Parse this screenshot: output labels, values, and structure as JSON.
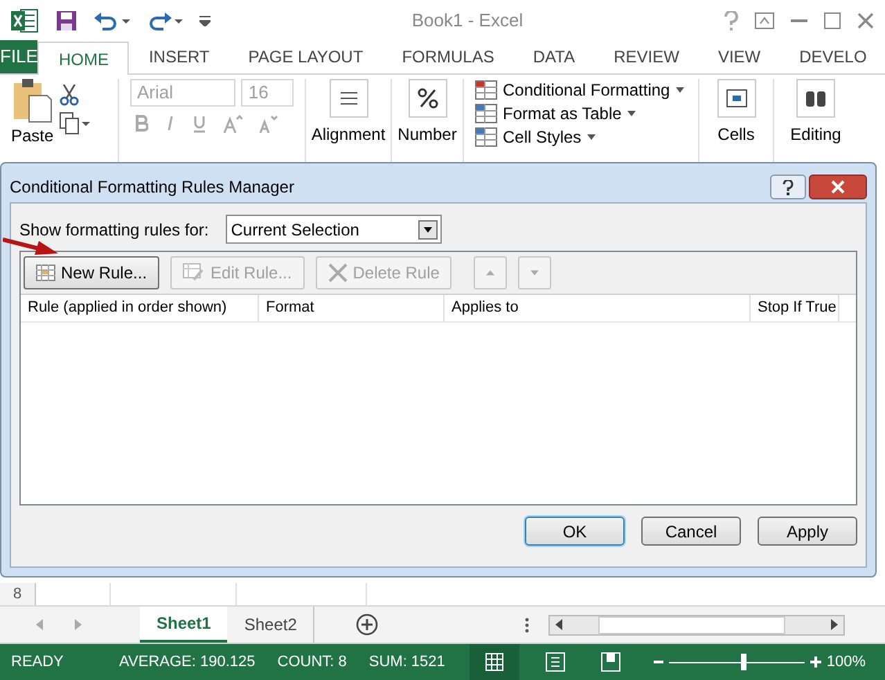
{
  "window": {
    "title": "Book1 - Excel"
  },
  "tabs": [
    {
      "label": "FILE",
      "kind": "file",
      "selected": false
    },
    {
      "label": "HOME",
      "kind": "tab",
      "selected": true
    },
    {
      "label": "INSERT",
      "kind": "tab",
      "selected": false
    },
    {
      "label": "PAGE LAYOUT",
      "kind": "tab",
      "selected": false
    },
    {
      "label": "FORMULAS",
      "kind": "tab",
      "selected": false
    },
    {
      "label": "DATA",
      "kind": "tab",
      "selected": false
    },
    {
      "label": "REVIEW",
      "kind": "tab",
      "selected": false
    },
    {
      "label": "VIEW",
      "kind": "tab",
      "selected": false
    },
    {
      "label": "DEVELO",
      "kind": "tab",
      "selected": false
    }
  ],
  "ribbon": {
    "paste": "Paste",
    "font_name": "Arial",
    "font_size": "16",
    "alignment": "Alignment",
    "number": "Number",
    "styles": [
      "Conditional Formatting",
      "Format as Table",
      "Cell Styles"
    ],
    "cells": "Cells",
    "editing": "Editing"
  },
  "dialog": {
    "title": "Conditional Formatting Rules Manager",
    "show_label": "Show formatting rules for:",
    "scope": "Current Selection",
    "toolbar": [
      {
        "label": "New Rule...",
        "kind": "new",
        "disabled": false
      },
      {
        "label": "Edit Rule...",
        "kind": "edit",
        "disabled": true
      },
      {
        "label": "Delete Rule",
        "kind": "delete",
        "disabled": true
      },
      {
        "kind": "up",
        "disabled": true
      },
      {
        "kind": "down",
        "disabled": true
      }
    ],
    "columns": [
      "Rule (applied in order shown)",
      "Format",
      "Applies to",
      "Stop If True"
    ],
    "buttons": [
      {
        "label": "OK",
        "selected": true
      },
      {
        "label": "Cancel",
        "selected": false
      },
      {
        "label": "Apply",
        "selected": false
      }
    ]
  },
  "sheet": {
    "row_header": "8",
    "sheets": [
      {
        "label": "Sheet1",
        "selected": true
      },
      {
        "label": "Sheet2",
        "selected": false
      }
    ]
  },
  "status_bar": {
    "ready": "READY",
    "average": "AVERAGE: 190.125",
    "count": "COUNT: 8",
    "sum": "SUM: 1521",
    "zoom": {
      "level": 0.55
    },
    "zoom_label": "100%"
  }
}
